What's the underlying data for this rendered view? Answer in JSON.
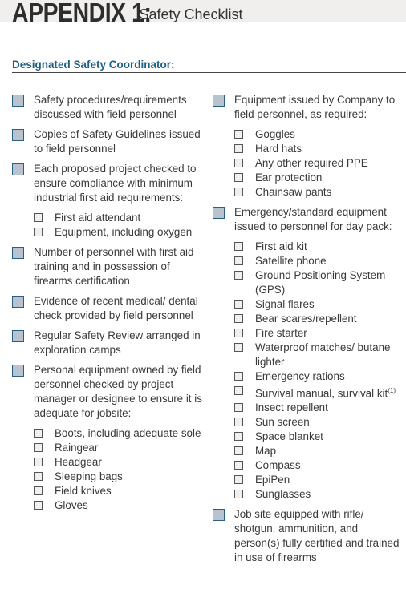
{
  "header": {
    "title_main": "APPENDIX 1:",
    "title_sub": "Safety Checklist"
  },
  "coordinator_label": "Designated Safety Coordinator:",
  "colors": {
    "accent": "#1f5f86",
    "checkbox_fill": "#b9c3d0",
    "band": "#f1efed"
  },
  "left_items": [
    {
      "text": "Safety procedures/requirements discussed with field personnel"
    },
    {
      "text": "Copies of Safety Guidelines issued to field personnel"
    },
    {
      "text": "Each proposed project checked to ensure compliance with minimum industrial first aid requirements:",
      "sub": [
        "First aid attendant",
        "Equipment, including oxygen"
      ]
    },
    {
      "text": "Number of personnel with first aid training and in possession of firearms certification"
    },
    {
      "text": "Evidence of recent medical/ dental check provided by field personnel"
    },
    {
      "text": "Regular Safety Review arranged in exploration camps"
    },
    {
      "text": "Personal equipment owned by field personnel checked by project manager or designee to ensure it is adequate for jobsite:",
      "sub": [
        "Boots, including adequate sole",
        "Raingear",
        "Headgear",
        "Sleeping bags",
        "Field knives",
        "Gloves"
      ]
    }
  ],
  "right_items": [
    {
      "text": "Equipment issued by Company to field personnel, as required:",
      "sub": [
        "Goggles",
        "Hard hats",
        "Any other required PPE",
        "Ear protection",
        "Chainsaw pants"
      ]
    },
    {
      "text": "Emergency/standard equipment issued to personnel for day pack:",
      "sub": [
        "First aid kit",
        "Satellite phone",
        "Ground Positioning System (GPS)",
        "Signal flares",
        "Bear scares/repellent",
        "Fire starter",
        "Waterproof matches/ butane lighter",
        "Emergency rations",
        "Survival manual, survival kit",
        "Insect repellent",
        "Sun screen",
        "Space blanket",
        "Map",
        "Compass",
        "EpiPen",
        "Sunglasses"
      ],
      "footnote_on": "Survival manual, survival kit",
      "footnote": "(1)"
    },
    {
      "text": "Job site equipped with rifle/ shotgun, ammunition, and person(s) fully certified and trained in use of firearms"
    }
  ]
}
